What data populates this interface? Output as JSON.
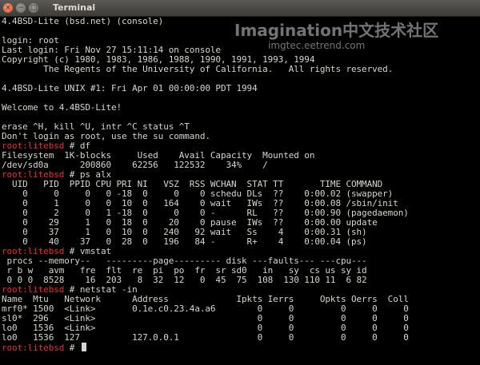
{
  "window": {
    "title": "Terminal",
    "buttons": {
      "close": "×",
      "minimize": "−",
      "maximize": "□"
    }
  },
  "watermark": {
    "title": "Imagination中文技术社区",
    "url": "imgtec.eetrend.com"
  },
  "terminal": {
    "lines": [
      {
        "text": "4.4BSD-Lite (bsd.net) (console)"
      },
      {
        "text": ""
      },
      {
        "text": "login: root"
      },
      {
        "text": "Last login: Fri Nov 27 15:11:14 on console"
      },
      {
        "text": "Copyright (c) 1980, 1983, 1986, 1988, 1990, 1991, 1993, 1994"
      },
      {
        "text": "        The Regents of the University of California.   All rights reserved."
      },
      {
        "text": ""
      },
      {
        "text": "4.4BSD-Lite UNIX #1: Fri Apr 01 00:00:00 PDT 1994"
      },
      {
        "text": ""
      },
      {
        "text": "Welcome to 4.4BSD-Lite!"
      },
      {
        "text": ""
      },
      {
        "text": "erase ^H, kill ^U, intr ^C status ^T"
      },
      {
        "text": "Don't login as root, use the su command."
      },
      {
        "prompt": "root:litebsd",
        "cmd": " # df"
      },
      {
        "text": "Filesystem  1K-blocks     Used    Avail Capacity  Mounted on"
      },
      {
        "text": "/dev/sd0a      200860    62256   122532    34%    /"
      },
      {
        "prompt": "root:litebsd",
        "cmd": " # ps alx"
      },
      {
        "text": "  UID   PID  PPID CPU PRI NI   VSZ  RSS WCHAN  STAT TT       TIME COMMAND"
      },
      {
        "text": "    0     0     0   0 -18  0     0    0 schedu DLs  ??    0:00.02 (swapper)"
      },
      {
        "text": "    0     1     0   0  10  0   164    0 wait   IWs  ??    0:00.08 /sbin/init"
      },
      {
        "text": "    0     2     0   1 -18  0     0    0 -      RL   ??    0:00.90 (pagedaemon)"
      },
      {
        "text": "    0    29     1   0  18  0    20    0 pause  IWs  ??    0:00.00 update"
      },
      {
        "text": "    0    37     1   0  10  0   240   92 wait   Ss    4    0:00.31 (sh)"
      },
      {
        "text": "    0    40    37   0  28  0   196   84 -      R+    4    0:00.04 (ps)"
      },
      {
        "prompt": "root:litebsd",
        "cmd": " # vmstat"
      },
      {
        "text": " procs --memory--   ---------page--------- disk ---faults--- ---cpu---"
      },
      {
        "text": " r b w   avm   fre  flt  re  pi  po  fr  sr sd0   in   sy  cs us sy id"
      },
      {
        "text": " 0 0 0  8528    16  203   8  32  12   0  45  75  108  130 110 11  6 82"
      },
      {
        "prompt": "root:litebsd",
        "cmd": " # netstat -in"
      },
      {
        "text": "Name  Mtu   Network      Address             Ipkts Ierrs     Opkts Oerrs  Coll"
      },
      {
        "text": "mrf0* 1500  <Link>       0.1e.c0.23.4a.a6        0     0         0     0     0"
      },
      {
        "text": "sl0*  296   <Link>                               0     0         0     0     0"
      },
      {
        "text": "lo0   1536  <Link>                               0     0         0     0     0"
      },
      {
        "text": "lo0   1536  127          127.0.0.1               0     0         0     0     0"
      },
      {
        "prompt": "root:litebsd",
        "cmd": " # ",
        "cursor": true
      }
    ]
  }
}
